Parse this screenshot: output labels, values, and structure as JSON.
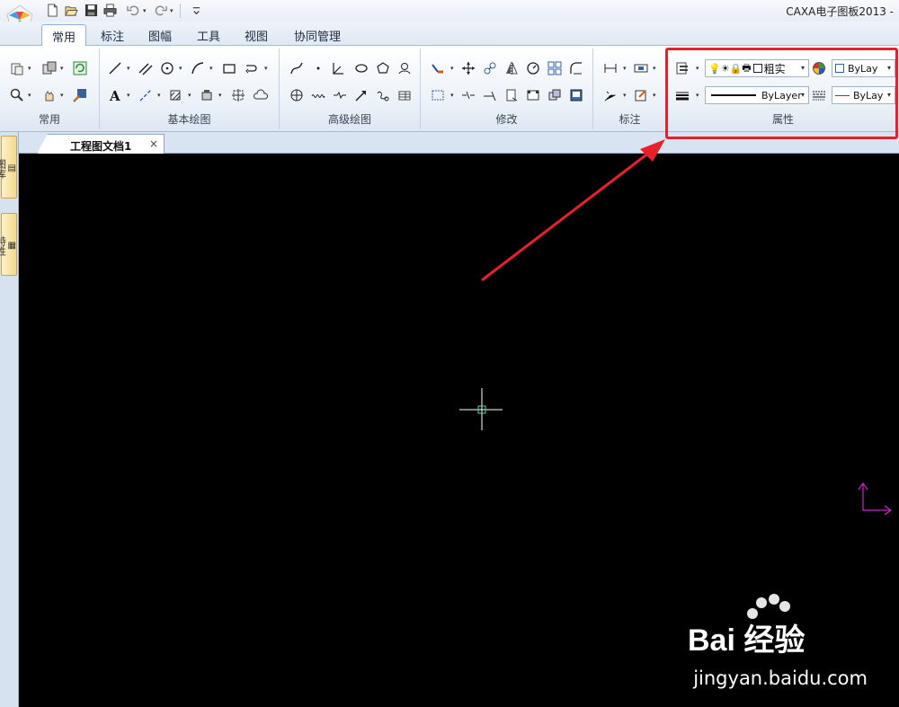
{
  "window": {
    "title": "CAXA电子图板2013 -"
  },
  "quick_access": {
    "items": [
      "new-icon",
      "open-icon",
      "save-icon",
      "print-icon",
      "undo-icon",
      "redo-icon",
      "customize-icon"
    ]
  },
  "ribbon_tabs": [
    {
      "label": "常用",
      "active": true
    },
    {
      "label": "标注",
      "active": false
    },
    {
      "label": "图幅",
      "active": false
    },
    {
      "label": "工具",
      "active": false
    },
    {
      "label": "视图",
      "active": false
    },
    {
      "label": "协同管理",
      "active": false
    }
  ],
  "ribbon_groups": {
    "common": "常用",
    "basic_draw": "基本绘图",
    "advanced_draw": "高级绘图",
    "modify": "修改",
    "annotate": "标注",
    "properties": "属性"
  },
  "properties": {
    "layer_value": "粗实",
    "color_value": "ByLay",
    "linetype_value": "ByLayer",
    "lineweight_value": "ByLay"
  },
  "side_panel": {
    "tab1": "图库",
    "tab2": "特性"
  },
  "document": {
    "tab_label": "工程图文档1",
    "close_glyph": "×"
  },
  "watermark": {
    "brand": "Bai 经验",
    "url": "jingyan.baidu.com"
  },
  "colors": {
    "canvas": "#000000",
    "highlight": "#e8202a",
    "crosshair": "#ffffff",
    "pickbox": "#4fd6a0",
    "ucs": "#d020d0"
  }
}
